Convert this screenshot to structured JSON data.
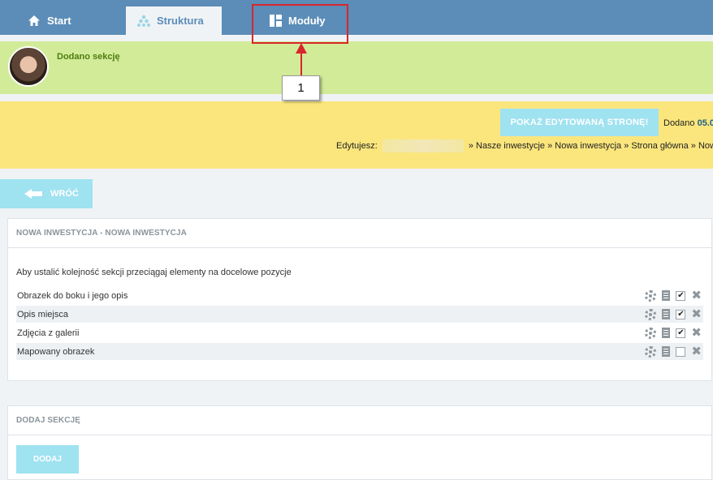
{
  "nav": {
    "tabs": [
      {
        "label": "Start",
        "icon": "home-icon"
      },
      {
        "label": "Struktura",
        "icon": "tree-icon"
      },
      {
        "label": "Moduły",
        "icon": "modules-icon"
      }
    ]
  },
  "annotation": {
    "callout": "1"
  },
  "notice": {
    "message": "Dodano sekcję"
  },
  "edit_bar": {
    "preview_button": "POKAŻ EDYTOWANĄ STRONĘ!",
    "added_label": "Dodano",
    "added_date": "05.0",
    "editing_label": "Edytujesz:",
    "breadcrumb": "» Nasze inwestycje » Nowa inwestycja » Strona główna » Nowa"
  },
  "back_button": "WRÓĆ",
  "sections_panel": {
    "title": "NOWA INWESTYCJA - NOWA INWESTYCJA",
    "help_text": "Aby ustalić kolejność sekcji przeciągaj elementy na docelowe pozycje",
    "rows": [
      {
        "label": "Obrazek do boku i jego opis",
        "checked": true
      },
      {
        "label": "Opis miejsca",
        "checked": true
      },
      {
        "label": "Zdjęcia z galerii",
        "checked": true
      },
      {
        "label": "Mapowany obrazek",
        "checked": false
      }
    ]
  },
  "add_panel": {
    "title": "DODAJ SEKCJĘ",
    "button": "DODAJ"
  },
  "colors": {
    "topbar": "#5b8db8",
    "notice_green": "#d2eb99",
    "notice_yellow": "#fbe67d",
    "button_cyan": "#9fe2f0",
    "annotation_red": "#d9262b"
  }
}
